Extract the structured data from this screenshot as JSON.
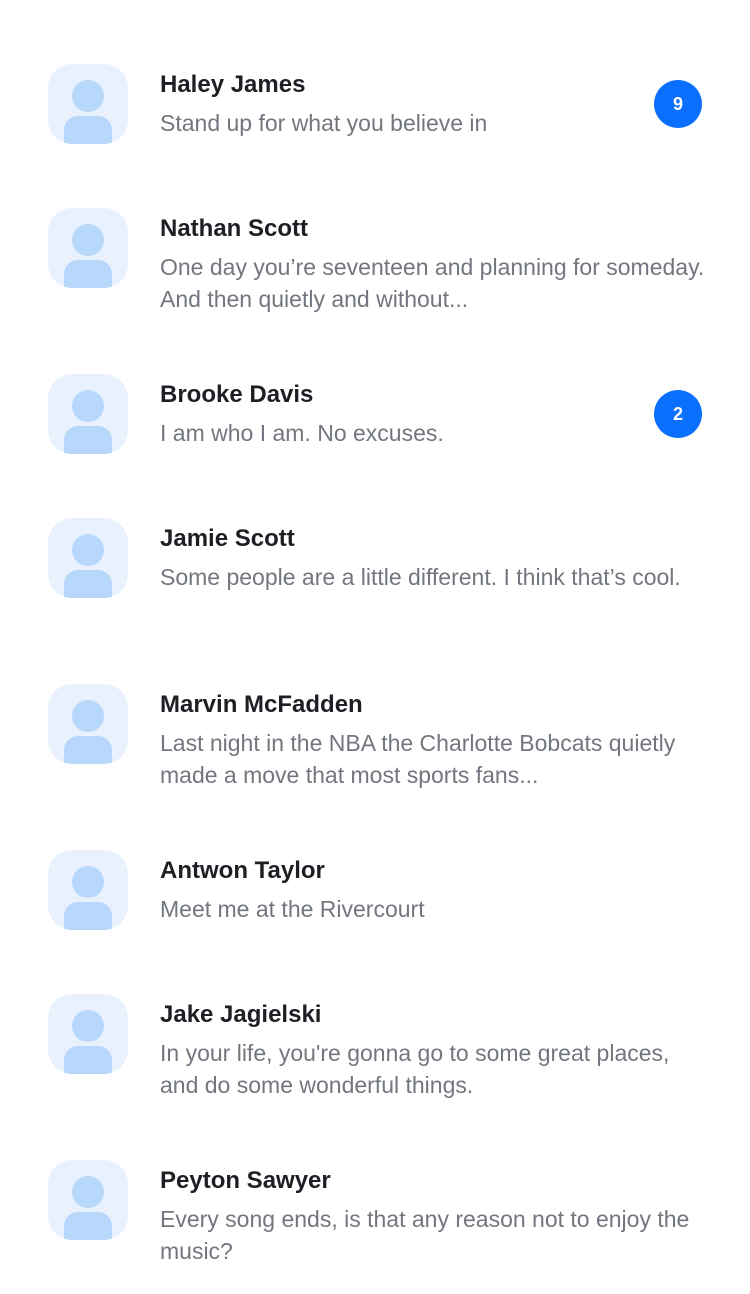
{
  "conversations": [
    {
      "name": "Haley James",
      "message": "Stand up for what you believe in",
      "unread": "9"
    },
    {
      "name": "Nathan Scott",
      "message": "One day you’re seventeen and planning for someday. And then quietly and without...",
      "unread": null
    },
    {
      "name": "Brooke Davis",
      "message": "I am who I am. No excuses.",
      "unread": "2"
    },
    {
      "name": "Jamie Scott",
      "message": "Some people are a little different. I think that’s cool.",
      "unread": null
    },
    {
      "name": "Marvin McFadden",
      "message": "Last night in the NBA the Charlotte Bobcats quietly made a move that most sports fans...",
      "unread": null
    },
    {
      "name": "Antwon Taylor",
      "message": "Meet me at the Rivercourt",
      "unread": null
    },
    {
      "name": "Jake Jagielski",
      "message": "In your life, you're gonna go to some great places, and do some wonderful things.",
      "unread": null
    },
    {
      "name": "Peyton Sawyer",
      "message": "Every song ends, is that any reason not to enjoy the music?",
      "unread": null
    }
  ],
  "icons": {
    "avatar": "user-avatar-icon"
  },
  "colors": {
    "badge": "#0B6FFD",
    "avatar_bg": "#E9F1FD",
    "avatar_fg": "#B7D7FB",
    "name_text": "#1D1F24",
    "message_text": "#72767E"
  }
}
